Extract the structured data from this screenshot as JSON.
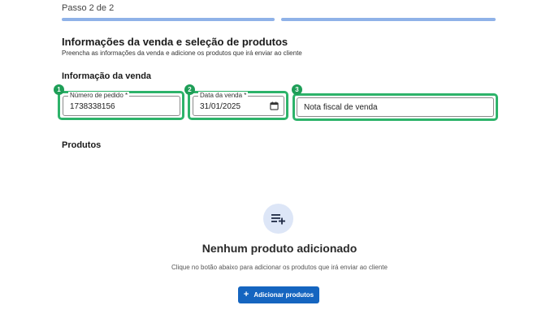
{
  "header": {
    "step_label": "Passo 2 de 2",
    "progress": {
      "current_step": 2,
      "total_steps": 2
    }
  },
  "section": {
    "title": "Informações da venda e seleção de produtos",
    "subtitle": "Preencha as informações da venda e adicione os produtos que irá enviar ao cliente"
  },
  "sale_info": {
    "heading": "Informação da venda",
    "fields": [
      {
        "badge": "1",
        "label": "Número de pedido *",
        "value": "1738338156"
      },
      {
        "badge": "2",
        "label": "Data da venda *",
        "value": "31/01/2025",
        "icon": "calendar-icon"
      },
      {
        "badge": "3",
        "value": "Nota fiscal de venda"
      }
    ]
  },
  "products": {
    "heading": "Produtos",
    "empty_icon": "playlist-add-icon",
    "empty_title": "Nenhum produto adicionado",
    "empty_description": "Clique no botão abaixo para adicionar os produtos que irá enviar ao cliente",
    "add_button_label": "Adicionar produtos",
    "add_button_icon": "plus-icon"
  },
  "colors": {
    "highlight": "#2db36a",
    "badge": "#1e9e57",
    "progress": "#8fb2e8",
    "primary_button": "#1565c0",
    "empty_icon_bg": "#dde6f7"
  }
}
